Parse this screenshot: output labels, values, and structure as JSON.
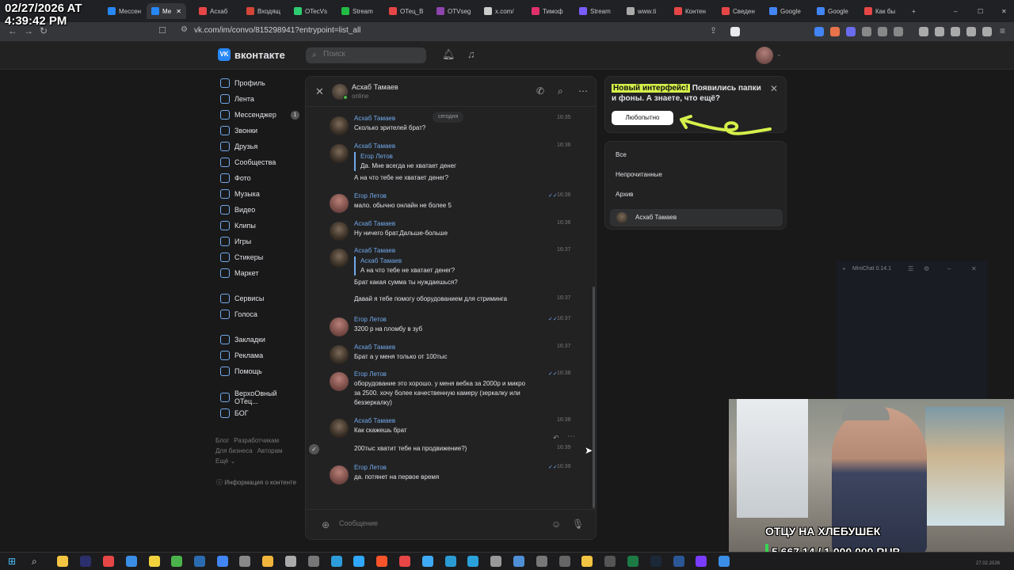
{
  "overlay_timestamp": {
    "date": "02/27/2026 AT",
    "time": "4:39:42 PM"
  },
  "browser": {
    "tabs": [
      {
        "label": "Мессен",
        "color": "#2787f5"
      },
      {
        "label": "Ме",
        "color": "#2787f5"
      },
      {
        "label": "Асхаб",
        "color": "#e64646"
      },
      {
        "label": "Входящ",
        "color": "#d44638"
      },
      {
        "label": "OTecVs",
        "color": "#2ecc71"
      },
      {
        "label": "Stream",
        "color": "#22bb44"
      },
      {
        "label": "ОТец_В",
        "color": "#e64646"
      },
      {
        "label": "OTVseg",
        "color": "#8e44ad"
      },
      {
        "label": "x.com/",
        "color": "#cccccc"
      },
      {
        "label": "Тимоф",
        "color": "#e1306c"
      },
      {
        "label": "Stream",
        "color": "#7a5cff"
      },
      {
        "label": "www.ti",
        "color": "#aaaaaa"
      },
      {
        "label": "Контен",
        "color": "#e64646"
      },
      {
        "label": "Сведен",
        "color": "#e64646"
      },
      {
        "label": "Google",
        "color": "#4285f4"
      },
      {
        "label": "Google",
        "color": "#4285f4"
      },
      {
        "label": "Как бы",
        "color": "#e64646"
      }
    ],
    "url": "vk.com/im/convo/815298941?entrypoint=list_all"
  },
  "vk": {
    "logo_text": "вконтакте",
    "search_placeholder": "Поиск",
    "nav": [
      {
        "label": "Профиль"
      },
      {
        "label": "Лента"
      },
      {
        "label": "Мессенджер",
        "badge": "1"
      },
      {
        "label": "Звонки"
      },
      {
        "label": "Друзья"
      },
      {
        "label": "Сообщества"
      },
      {
        "label": "Фото"
      },
      {
        "label": "Музыка"
      },
      {
        "label": "Видео"
      },
      {
        "label": "Клипы"
      },
      {
        "label": "Игры"
      },
      {
        "label": "Стикеры"
      },
      {
        "label": "Маркет"
      },
      {
        "label": "Сервисы"
      },
      {
        "label": "Голоса"
      },
      {
        "label": "Закладки"
      },
      {
        "label": "Реклама"
      },
      {
        "label": "Помощь"
      },
      {
        "label": "ВерхоОвный ОТец..."
      },
      {
        "label": "БОГ"
      }
    ],
    "footer": {
      "blog": "Блог",
      "devs": "Разработчикам",
      "biz": "Для бизнеса",
      "authors": "Авторам",
      "more": "Ещё ⌄"
    },
    "info": "Информация о контенте"
  },
  "chat": {
    "name": "Асхаб Тамаев",
    "status": "online",
    "day": "сегодня",
    "messages": [
      {
        "author": "Асхаб Тамаев",
        "lines": [
          "Сколько зрителей брат?"
        ],
        "time": "16:35"
      },
      {
        "author": "Асхаб Тамаев",
        "reply_author": "Егор Летов",
        "reply_text": "Да. Мне всегда не хватает денег",
        "lines": [
          "А на что тебе не хватает денег?"
        ],
        "time": "16:36"
      },
      {
        "author": "Егор Летов",
        "lines": [
          "мало. обычно онлайн не более 5"
        ],
        "time": "16:36"
      },
      {
        "author": "Асхаб Тамаев",
        "lines": [
          "Ну ничего брат.Дальше-больше"
        ],
        "time": "16:36"
      },
      {
        "author": "Асхаб Тамаев",
        "reply_author": "Асхаб Тамаев",
        "reply_text": "А на что тебе не хватает денег?",
        "lines": [
          "Брат какая сумма ты нуждаешься?"
        ],
        "time": "16:37"
      },
      {
        "author": "",
        "lines": [
          "Давай я тебе помогу оборудованием для стриминга"
        ],
        "time": "16:37"
      },
      {
        "author": "Егор Летов",
        "lines": [
          "3200 р на пломбу в зуб"
        ],
        "time": "16:37"
      },
      {
        "author": "Асхаб Тамаев",
        "lines": [
          "Брат а у меня только от 100тыс"
        ],
        "time": "16:37"
      },
      {
        "author": "Егор Летов",
        "lines": [
          "оборудование это хорошо. у меня вебка за 2000р и микро",
          "за 2500. хочу более качественную камеру (зеркалку или",
          "беззеркалку)"
        ],
        "time": "16:38"
      },
      {
        "author": "Асхаб Тамаев",
        "lines": [
          "Как скажешь брат"
        ],
        "time": "16:38"
      },
      {
        "author": "",
        "lines": [
          "200тыс хватит тебе на продвижение?)"
        ],
        "time": "16:39"
      },
      {
        "author": "Егор Летов",
        "lines": [
          "да. потянет на первое время"
        ],
        "time": "16:39"
      }
    ],
    "composer_placeholder": "Сообщение"
  },
  "notice": {
    "highlight": "Новый интерфейс!",
    "text": " Появились папки и фоны. А знаете, что ещё?",
    "button": "Любопытно"
  },
  "folders": {
    "items": [
      "Все",
      "Непрочитанные",
      "Архив"
    ],
    "contact": "Асхаб Тамаев"
  },
  "minichat": {
    "title": "MiniChat 0.14.1"
  },
  "stream": {
    "label": "ОТЦУ НА ХЛЕБУШЕК",
    "goal": "5 667.14 / 1 000 000 RUB"
  },
  "taskbar_date": "27.02.2026"
}
